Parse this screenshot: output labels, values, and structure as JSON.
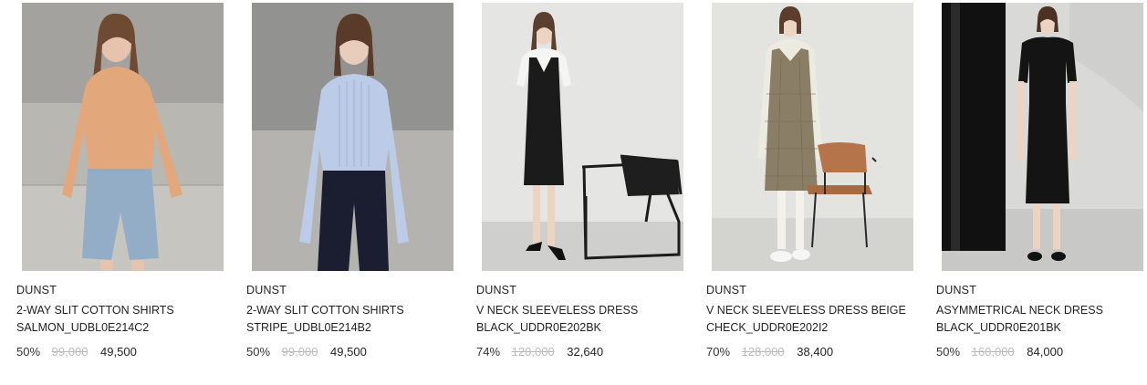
{
  "products": [
    {
      "brand": "DUNST",
      "name_line1": "2-WAY SLIT COTTON SHIRTS",
      "name_line2": "SALMON_UDBL0E214C2",
      "discount": "50%",
      "original_price": "99,000",
      "sale_price": "49,500",
      "colors": {
        "bg": "#b7b6b1",
        "garment": "#e0a57a",
        "bottom": "#8fa8c2"
      }
    },
    {
      "brand": "DUNST",
      "name_line1": "2-WAY SLIT COTTON SHIRTS",
      "name_line2": "STRIPE_UDBL0E214B2",
      "discount": "50%",
      "original_price": "99,000",
      "sale_price": "49,500",
      "colors": {
        "bg": "#a9a9a7",
        "garment": "#b9c9e6",
        "bottom": "#1a1d2e"
      }
    },
    {
      "brand": "DUNST",
      "name_line1": "V NECK SLEEVELESS DRESS",
      "name_line2": "BLACK_UDDR0E202BK",
      "discount": "74%",
      "original_price": "120,000",
      "sale_price": "32,640",
      "colors": {
        "bg": "#e4e4e2",
        "garment": "#1b1b1b",
        "bottom": "#f3f3f1"
      }
    },
    {
      "brand": "DUNST",
      "name_line1": "V NECK SLEEVELESS DRESS BEIGE",
      "name_line2": "CHECK_UDDR0E202I2",
      "discount": "70%",
      "original_price": "128,000",
      "sale_price": "38,400",
      "colors": {
        "bg": "#e2e2df",
        "garment": "#8a7f66",
        "bottom": "#e9e8dc"
      }
    },
    {
      "brand": "DUNST",
      "name_line1": "ASYMMETRICAL NECK DRESS",
      "name_line2": "BLACK_UDDR0E201BK",
      "discount": "50%",
      "original_price": "160,000",
      "sale_price": "84,000",
      "colors": {
        "bg": "#d8d8d6",
        "garment": "#141414",
        "bottom": "#141414"
      }
    }
  ]
}
